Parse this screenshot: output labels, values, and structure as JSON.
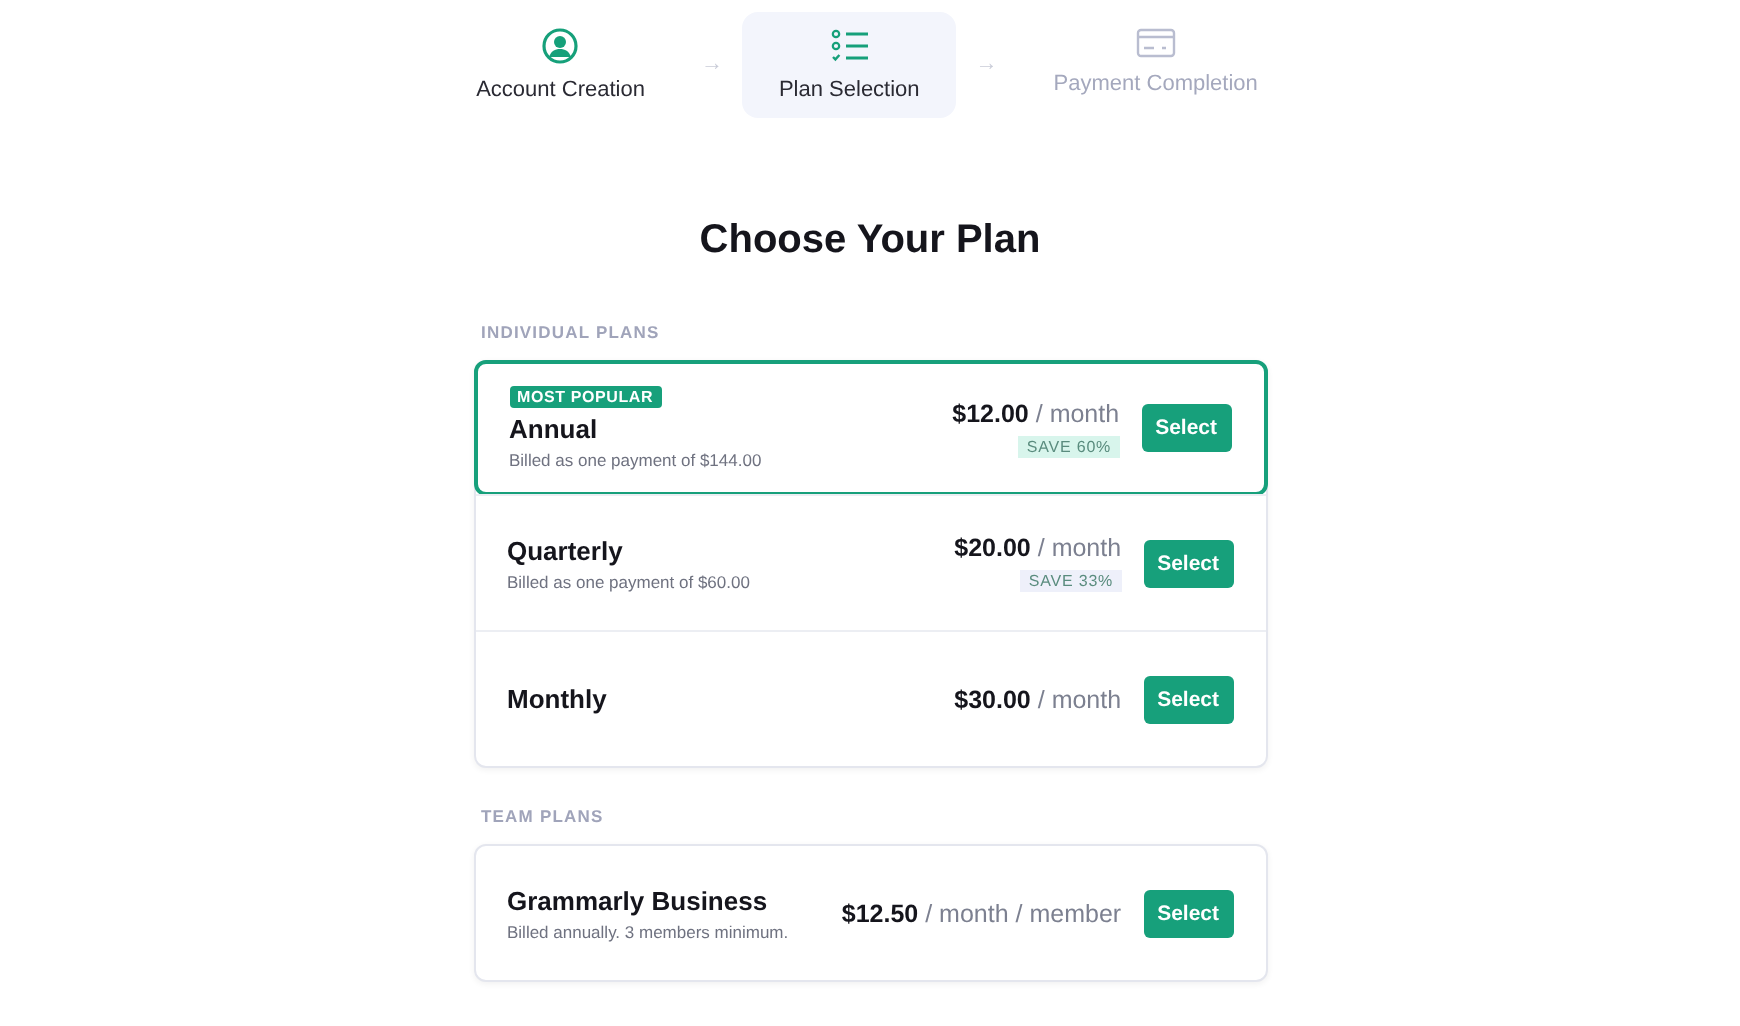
{
  "steps": [
    {
      "label": "Account Creation",
      "kind": "account",
      "disabled": false,
      "selected": false
    },
    {
      "label": "Plan Selection",
      "kind": "plan",
      "disabled": false,
      "selected": true
    },
    {
      "label": "Payment Completion",
      "kind": "payment",
      "disabled": true,
      "selected": false
    }
  ],
  "step_arrow": "→",
  "title": "Choose Your Plan",
  "sections": [
    {
      "label": "INDIVIDUAL PLANS",
      "plans": [
        {
          "name": "Annual",
          "badge": "MOST POPULAR",
          "highlighted": true,
          "note": "Billed as one payment of $144.00",
          "price": "$12.00",
          "unit": "/ month",
          "save": "SAVE 60%",
          "color": "#d8f5ec",
          "button": "Select"
        },
        {
          "name": "Quarterly",
          "highlighted": false,
          "note": "Billed as one payment of $60.00",
          "price": "$20.00",
          "unit": "/ month",
          "save": "SAVE 33%",
          "color": "#eef0fa",
          "button": "Select"
        },
        {
          "name": "Monthly",
          "highlighted": false,
          "price": "$30.00",
          "unit": "/ month",
          "button": "Select"
        }
      ]
    },
    {
      "label": "TEAM PLANS",
      "plans": [
        {
          "name": "Grammarly Business",
          "highlighted": false,
          "note": "Billed annually. 3 members minimum.",
          "price": "$12.50",
          "unit": "/ month / member",
          "button": "Select"
        }
      ]
    }
  ]
}
